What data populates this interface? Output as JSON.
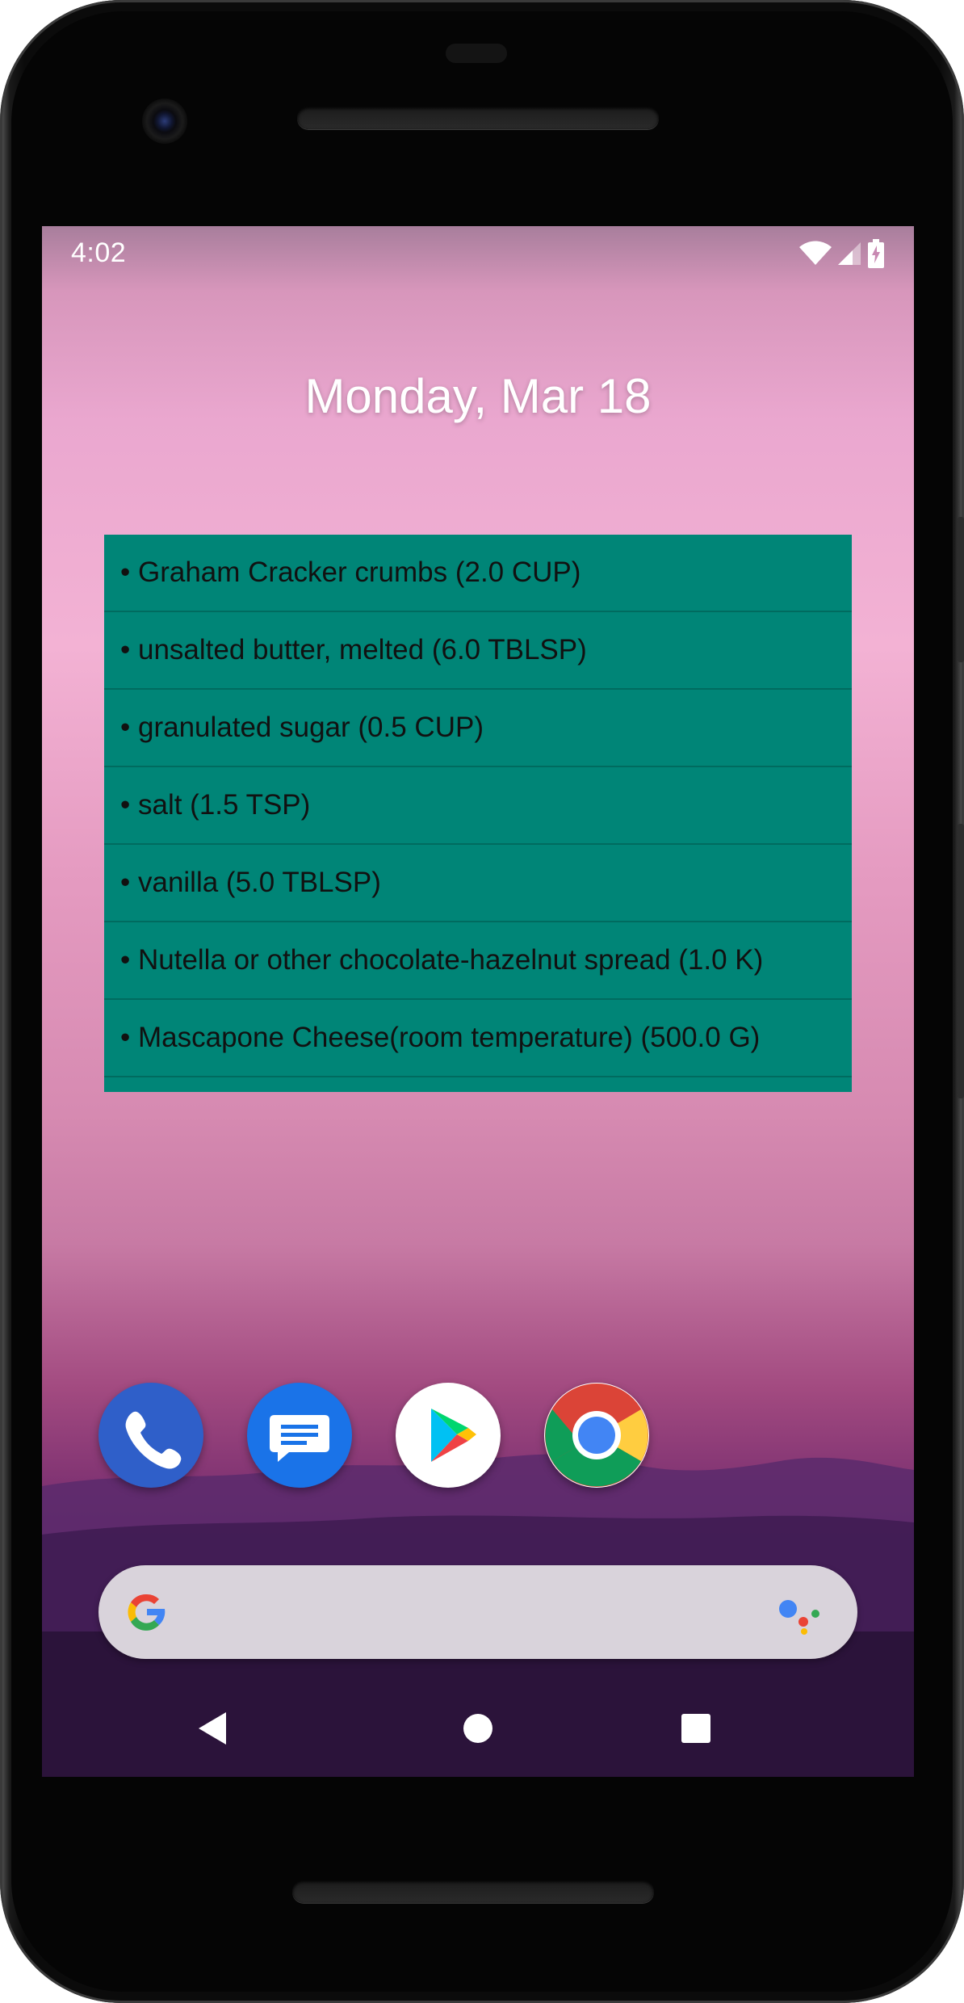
{
  "status_bar": {
    "time": "4:02",
    "icons": [
      "wifi-icon",
      "cell-signal-icon",
      "battery-charging-icon"
    ]
  },
  "home": {
    "date": "Monday, Mar 18"
  },
  "widget": {
    "background": "#008577",
    "items": [
      "• Graham Cracker crumbs (2.0 CUP)",
      "• unsalted butter, melted (6.0 TBLSP)",
      "• granulated sugar (0.5 CUP)",
      "• salt (1.5 TSP)",
      "• vanilla (5.0 TBLSP)",
      "• Nutella or other chocolate-hazelnut spread (1.0 K)",
      "• Mascapone Cheese(room temperature) (500.0 G)"
    ]
  },
  "dock": {
    "apps": [
      "phone-app-icon",
      "messages-app-icon",
      "play-store-app-icon",
      "chrome-app-icon"
    ]
  },
  "search": {
    "icons": [
      "google-g-icon",
      "google-assistant-icon"
    ]
  },
  "nav": {
    "buttons": [
      "back-icon",
      "home-icon",
      "recents-icon"
    ]
  }
}
